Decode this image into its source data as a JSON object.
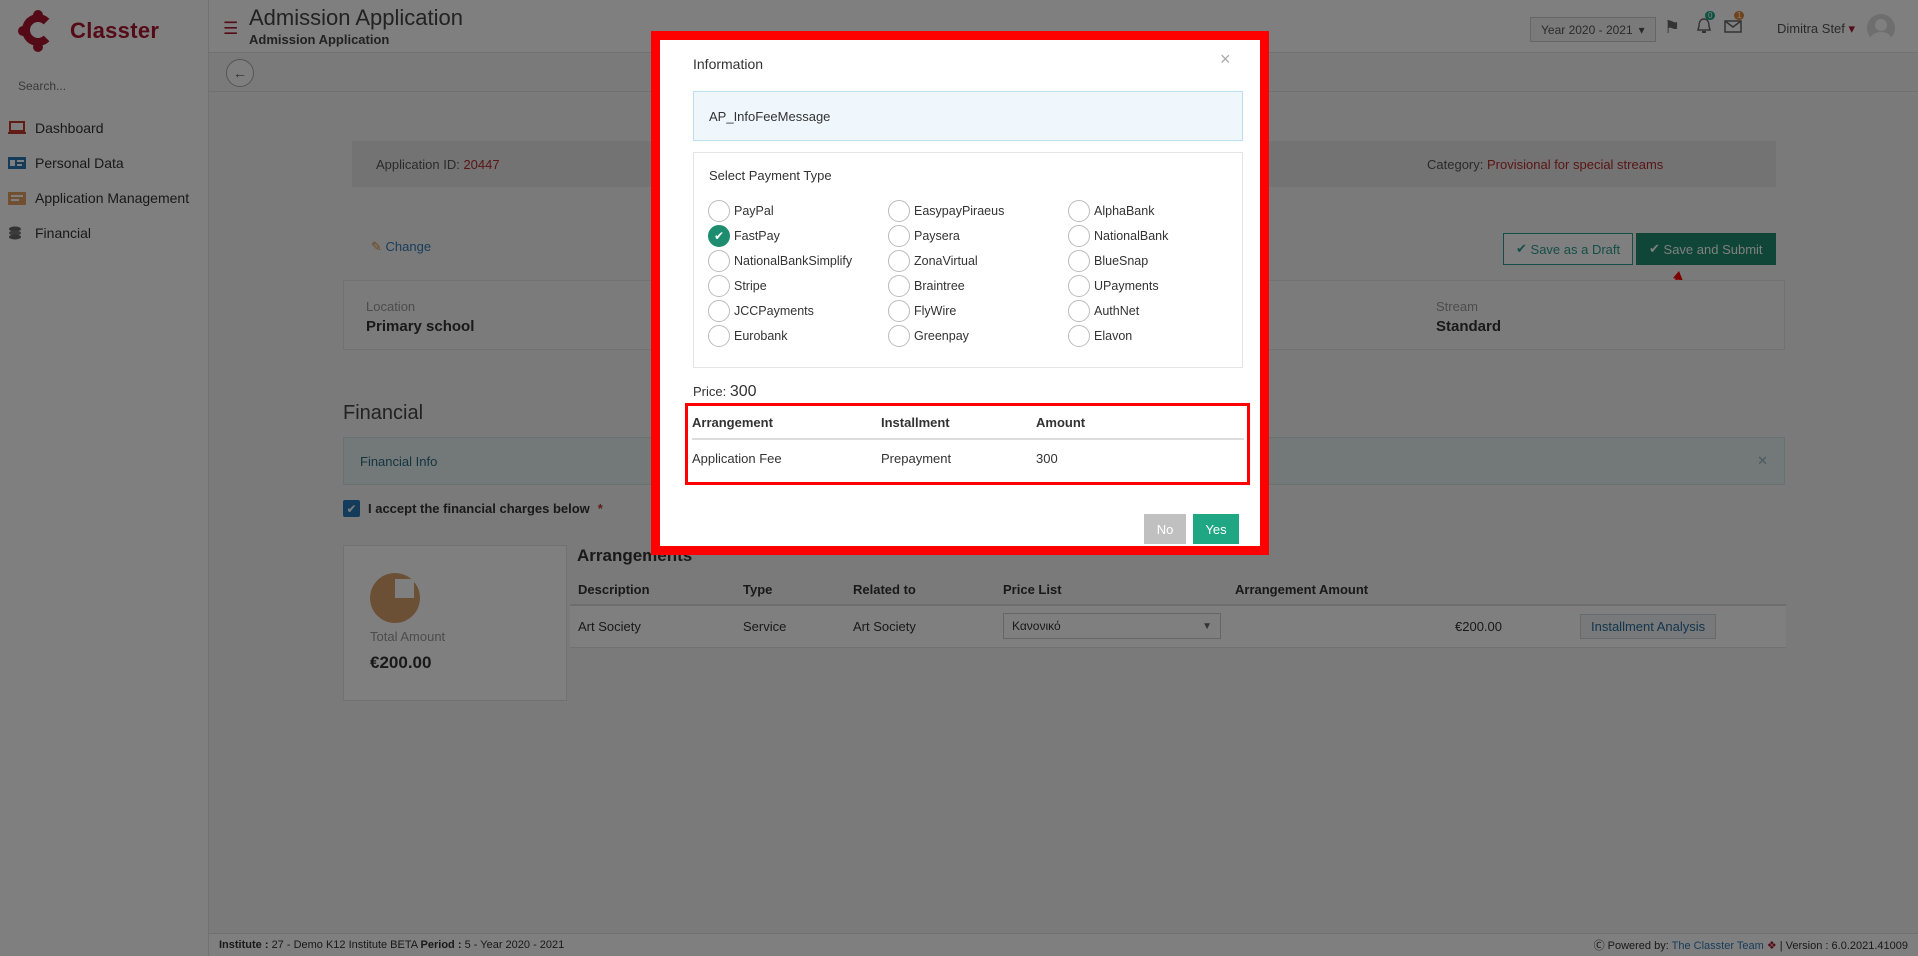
{
  "brand": {
    "name": "Classter"
  },
  "sidebar": {
    "search_placeholder": "Search...",
    "items": [
      {
        "label": "Dashboard",
        "icon": "laptop-icon",
        "color": "#c0392b"
      },
      {
        "label": "Personal Data",
        "icon": "id-card-icon",
        "color": "#2a76b5"
      },
      {
        "label": "Application Management",
        "icon": "folder-icon",
        "color": "#e0a060"
      },
      {
        "label": "Financial",
        "icon": "coins-icon",
        "color": "#666666"
      }
    ]
  },
  "header": {
    "title": "Admission Application",
    "subtitle": "Admission Application",
    "year_select": "Year 2020 - 2021",
    "notif_count": "0",
    "mail_count": "1",
    "user_name": "Dimitra Stef"
  },
  "application": {
    "id_label": "Application ID:",
    "id_value": "20447",
    "category_label": "Category:",
    "category_value": "Provisional for special streams",
    "change_label": "Change",
    "draft_button": "Save as a Draft",
    "submit_button": "Save and Submit",
    "fields": [
      {
        "key": "Location",
        "value": "Primary school"
      },
      {
        "key": "Stream",
        "value": "Standard"
      }
    ]
  },
  "financial": {
    "section_title": "Financial",
    "info_label": "Financial Info",
    "accept_label": "I accept the financial charges below",
    "total_label": "Total Amount",
    "total_value": "€200.00",
    "arrangements_title": "Arrangements",
    "columns": [
      "Description",
      "Type",
      "Related to",
      "Price List",
      "Arrangement Amount"
    ],
    "rows": [
      {
        "description": "Art Society",
        "type": "Service",
        "related_to": "Art Society",
        "price_list": "Κανονικό",
        "amount": "€200.00",
        "action": "Installment Analysis"
      }
    ]
  },
  "footer": {
    "institute_label": "Institute :",
    "institute_value": "27 - Demo K12 Institute BETA",
    "period_label": "Period :",
    "period_value": "5 - Year 2020 - 2021",
    "powered_by": "Powered by:",
    "team": "The Classter Team",
    "version": "| Version : 6.0.2021.41009"
  },
  "modal": {
    "title": "Information",
    "message": "AP_InfoFeeMessage",
    "payment_title": "Select Payment Type",
    "payment_options": [
      "PayPal",
      "EasypayPiraeus",
      "AlphaBank",
      "FastPay",
      "Paysera",
      "NationalBank",
      "NationalBankSimplify",
      "ZonaVirtual",
      "BlueSnap",
      "Stripe",
      "Braintree",
      "UPayments",
      "JCCPayments",
      "FlyWire",
      "AuthNet",
      "Eurobank",
      "Greenpay",
      "Elavon"
    ],
    "selected_option": "FastPay",
    "price_label": "Price:",
    "price_value": "300",
    "fee_columns": [
      "Arrangement",
      "Installment",
      "Amount"
    ],
    "fee_rows": [
      {
        "arrangement": "Application Fee",
        "installment": "Prepayment",
        "amount": "300"
      }
    ],
    "no_button": "No",
    "yes_button": "Yes"
  },
  "colors": {
    "brand": "#a8172e",
    "accent": "#1e8c6f",
    "highlight": "#ff0000"
  }
}
